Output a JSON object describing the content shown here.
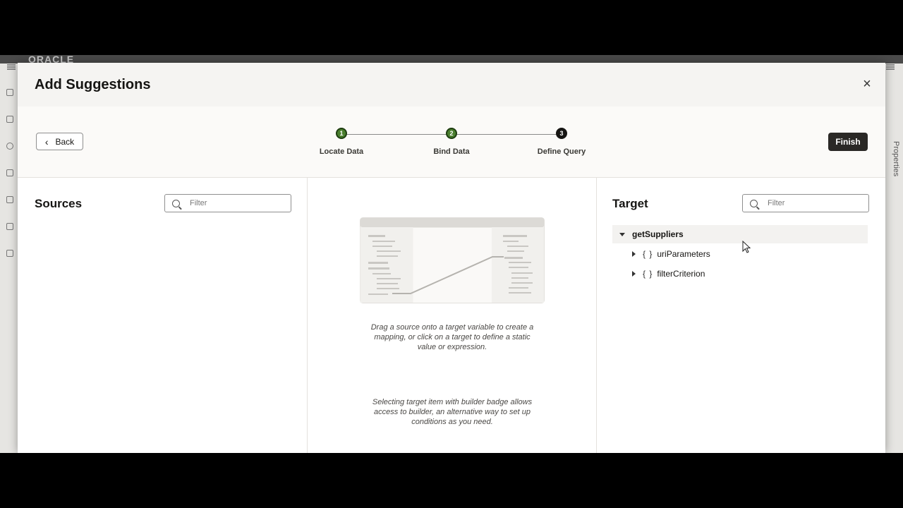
{
  "background_app": {
    "brand": "ORACLE",
    "right_tab": "Properties"
  },
  "dialog": {
    "title": "Add Suggestions",
    "close_label": "×"
  },
  "train": {
    "back_label": "Back",
    "finish_label": "Finish",
    "steps": [
      {
        "number": "1",
        "label": "Locate Data",
        "state": "done"
      },
      {
        "number": "2",
        "label": "Bind Data",
        "state": "done"
      },
      {
        "number": "3",
        "label": "Define Query",
        "state": "current"
      }
    ]
  },
  "sources": {
    "title": "Sources",
    "filter_placeholder": "Filter"
  },
  "middle": {
    "hint_1": "Drag a source onto a target variable to create a mapping, or click on a target to define a static value or expression.",
    "hint_2": "Selecting target item with builder badge allows access to builder, an alternative way to set up conditions as you need."
  },
  "target": {
    "title": "Target",
    "filter_placeholder": "Filter",
    "root": "getSuppliers",
    "children": [
      {
        "label": "uriParameters",
        "icon": "braces-icon"
      },
      {
        "label": "filterCriterion",
        "icon": "braces-icon"
      }
    ],
    "brace_glyph": "{ }"
  },
  "colors": {
    "step_done": "#4a7f2e",
    "step_current": "#161513",
    "finish_bg": "#2a2826"
  }
}
